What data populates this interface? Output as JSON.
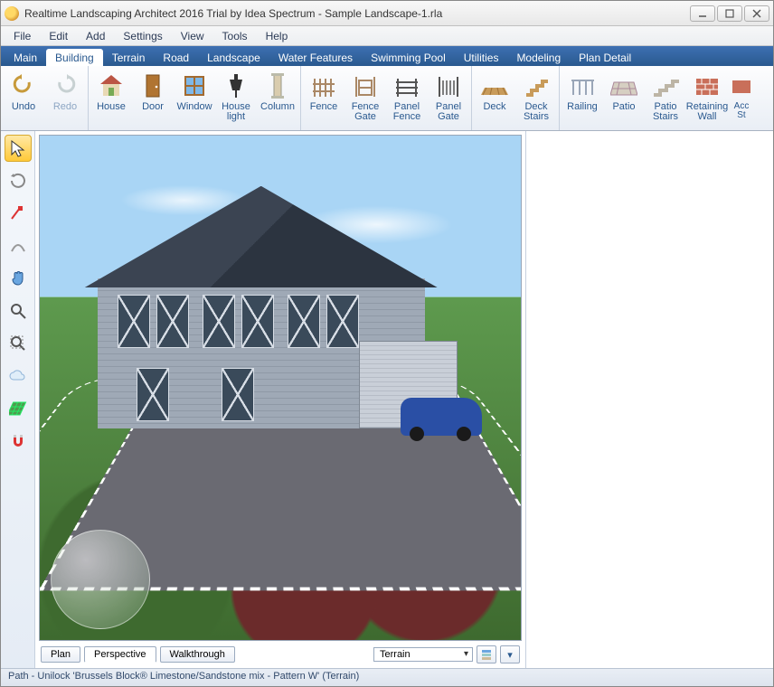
{
  "window": {
    "title": "Realtime Landscaping Architect 2016 Trial by Idea Spectrum - Sample Landscape-1.rla"
  },
  "menubar": {
    "items": [
      "File",
      "Edit",
      "Add",
      "Settings",
      "View",
      "Tools",
      "Help"
    ]
  },
  "ribbon": {
    "tabs": [
      "Main",
      "Building",
      "Terrain",
      "Road",
      "Landscape",
      "Water Features",
      "Swimming Pool",
      "Utilities",
      "Modeling",
      "Plan Detail"
    ],
    "active_tab_index": 1,
    "groups": [
      {
        "buttons": [
          {
            "label": "Undo",
            "icon": "undo"
          },
          {
            "label": "Redo",
            "icon": "redo",
            "disabled": true
          }
        ]
      },
      {
        "buttons": [
          {
            "label": "House",
            "icon": "house"
          },
          {
            "label": "Door",
            "icon": "door"
          },
          {
            "label": "Window",
            "icon": "window"
          },
          {
            "label": "House light",
            "icon": "lamp"
          },
          {
            "label": "Column",
            "icon": "column"
          }
        ]
      },
      {
        "buttons": [
          {
            "label": "Fence",
            "icon": "fence"
          },
          {
            "label": "Fence Gate",
            "icon": "fence-gate"
          },
          {
            "label": "Panel Fence",
            "icon": "panel-fence"
          },
          {
            "label": "Panel Gate",
            "icon": "panel-gate"
          }
        ]
      },
      {
        "buttons": [
          {
            "label": "Deck",
            "icon": "deck"
          },
          {
            "label": "Deck Stairs",
            "icon": "deck-stairs"
          }
        ]
      },
      {
        "buttons": [
          {
            "label": "Railing",
            "icon": "railing"
          },
          {
            "label": "Patio",
            "icon": "patio"
          },
          {
            "label": "Patio Stairs",
            "icon": "patio-stairs"
          },
          {
            "label": "Retaining Wall",
            "icon": "wall"
          },
          {
            "label": "Accent Strip",
            "icon": "accent",
            "clipped": true
          }
        ]
      }
    ]
  },
  "left_tools": [
    {
      "name": "select-tool",
      "active": true
    },
    {
      "name": "orbit-tool"
    },
    {
      "name": "move-point-tool"
    },
    {
      "name": "curve-tool"
    },
    {
      "name": "pan-tool"
    },
    {
      "name": "zoom-tool"
    },
    {
      "name": "zoom-region-tool"
    },
    {
      "name": "freeform-tool"
    },
    {
      "name": "grid-toggle"
    },
    {
      "name": "snap-toggle"
    }
  ],
  "viewbar": {
    "modes": [
      "Plan",
      "Perspective",
      "Walkthrough"
    ],
    "active_mode_index": 1,
    "layer_select": "Terrain"
  },
  "statusbar": {
    "text": "Path - Unilock 'Brussels Block® Limestone/Sandstone mix - Pattern W' (Terrain)"
  }
}
